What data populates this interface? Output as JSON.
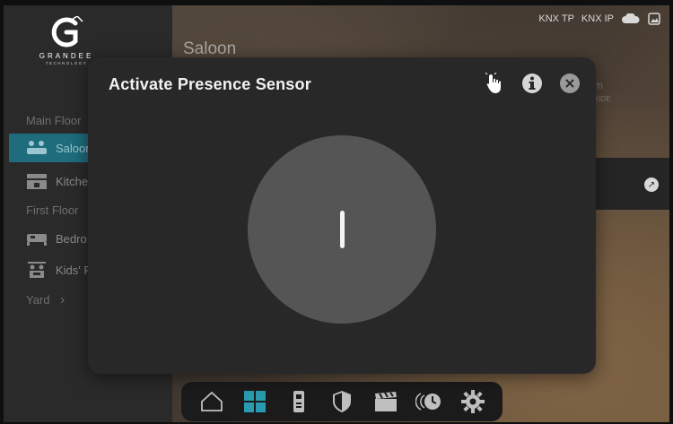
{
  "brand": {
    "name": "GRANDEE",
    "sub": "TECHNOLOGY"
  },
  "status": {
    "knx_tp": "KNX TP",
    "knx_ip": "KNX IP"
  },
  "room_title": "Saloon",
  "sidebar": {
    "sections": [
      {
        "label": "Main Floor"
      },
      {
        "label": "First Floor"
      },
      {
        "label": "Yard"
      }
    ],
    "items": [
      {
        "label": "Saloon",
        "icon": "sofa-people-icon"
      },
      {
        "label": "Kitche",
        "icon": "kitchen-icon"
      },
      {
        "label": "Bedro",
        "icon": "bed-icon"
      },
      {
        "label": "Kids' R",
        "icon": "kids-room-icon"
      }
    ],
    "yard_chevron": "›"
  },
  "background_fragments": {
    "side_text": "m",
    "side_text2": "XIDE"
  },
  "modal": {
    "title": "Activate Presence Sensor",
    "toggle_state": "off"
  },
  "dock": {
    "items": [
      {
        "icon": "home-icon"
      },
      {
        "icon": "grid-icon"
      },
      {
        "icon": "intercom-icon"
      },
      {
        "icon": "shield-icon"
      },
      {
        "icon": "scene-clapper-icon"
      },
      {
        "icon": "schedule-icon"
      },
      {
        "icon": "settings-gear-icon"
      }
    ]
  },
  "colors": {
    "accent": "#1e6c7c",
    "modal_bg": "#282829",
    "toggle_bg": "#555556"
  }
}
